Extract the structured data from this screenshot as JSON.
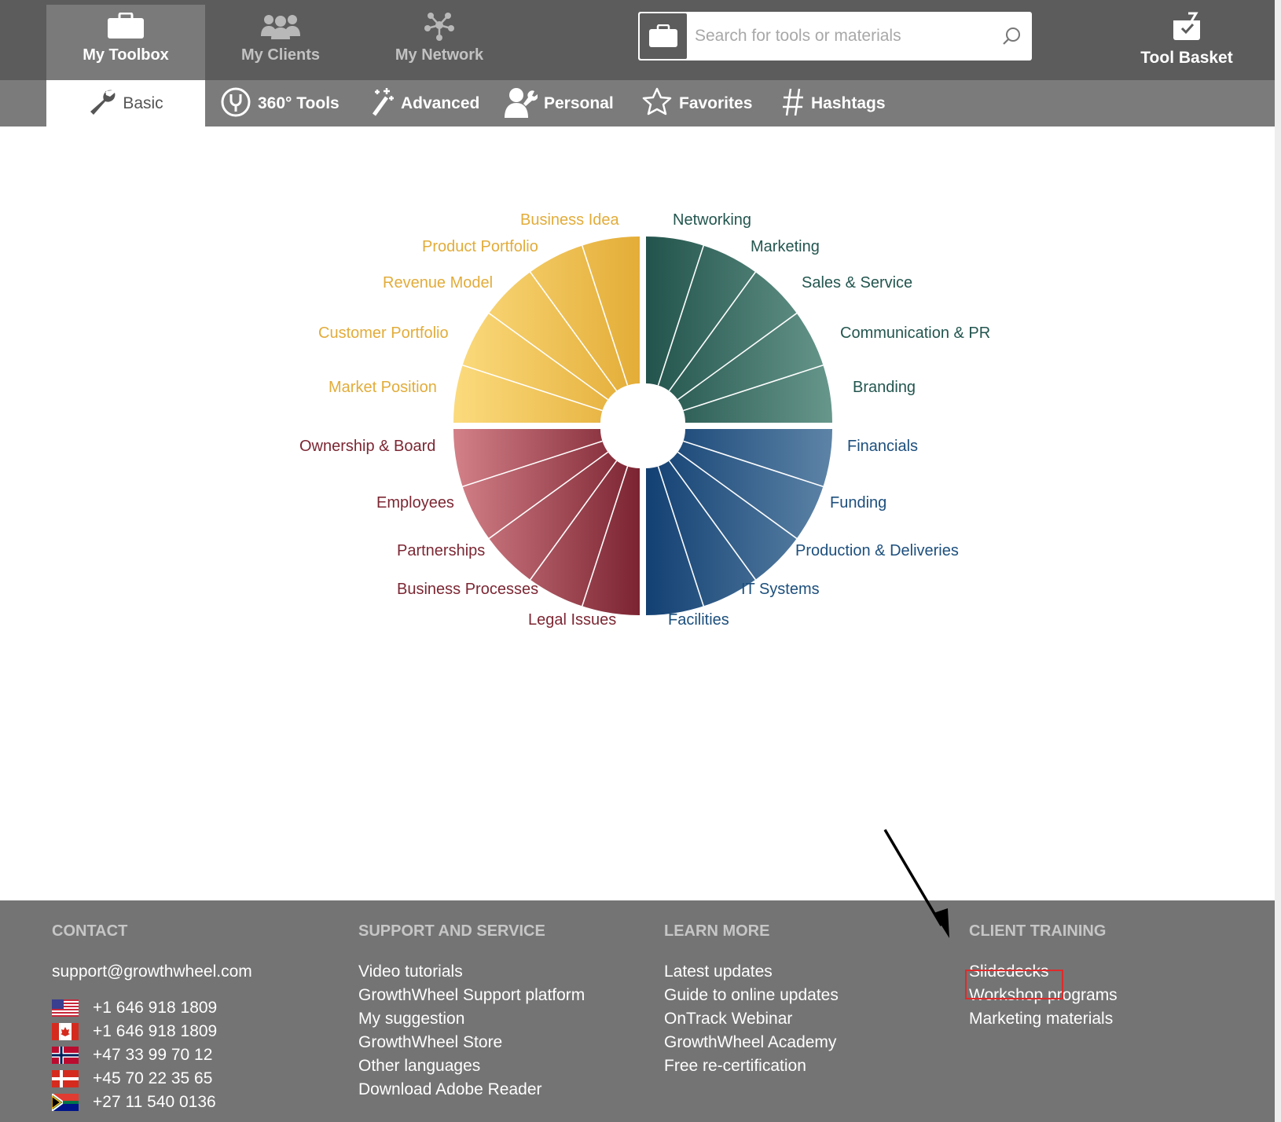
{
  "nav": {
    "main_tabs": [
      {
        "label": "My Toolbox",
        "icon": "toolbox-icon",
        "active": true
      },
      {
        "label": "My Clients",
        "icon": "clients-icon",
        "active": false
      },
      {
        "label": "My Network",
        "icon": "network-icon",
        "active": false
      }
    ],
    "search": {
      "placeholder": "Search for tools or materials",
      "value": ""
    },
    "basket_label": "Tool Basket",
    "sub_tabs": [
      {
        "label": "Basic",
        "icon": "wrench-icon",
        "active": true
      },
      {
        "label": "360° Tools",
        "icon": "tools-360-icon",
        "active": false
      },
      {
        "label": "Advanced",
        "icon": "magic-wand-icon",
        "active": false
      },
      {
        "label": "Personal",
        "icon": "person-wrench-icon",
        "active": false
      },
      {
        "label": "Favorites",
        "icon": "star-icon",
        "active": false
      },
      {
        "label": "Hashtags",
        "icon": "hashtag-icon",
        "active": false
      }
    ]
  },
  "wheel": {
    "colors": {
      "yellow": "#e5b23e",
      "teal": "#2a5e58",
      "red": "#7e2935",
      "blue": "#164f80",
      "yellow_text": "#e2ac3a",
      "teal_text": "#23564f",
      "red_text": "#7c2733",
      "blue_text": "#1c4f7d"
    },
    "segments": [
      {
        "label": "Business Idea",
        "group": "yellow"
      },
      {
        "label": "Product Portfolio",
        "group": "yellow"
      },
      {
        "label": "Revenue Model",
        "group": "yellow"
      },
      {
        "label": "Customer Portfolio",
        "group": "yellow"
      },
      {
        "label": "Market Position",
        "group": "yellow"
      },
      {
        "label": "Networking",
        "group": "teal"
      },
      {
        "label": "Marketing",
        "group": "teal"
      },
      {
        "label": "Sales & Service",
        "group": "teal"
      },
      {
        "label": "Communication & PR",
        "group": "teal"
      },
      {
        "label": "Branding",
        "group": "teal"
      },
      {
        "label": "Ownership & Board",
        "group": "red"
      },
      {
        "label": "Employees",
        "group": "red"
      },
      {
        "label": "Partnerships",
        "group": "red"
      },
      {
        "label": "Business Processes",
        "group": "red"
      },
      {
        "label": "Legal Issues",
        "group": "red"
      },
      {
        "label": "Financials",
        "group": "blue"
      },
      {
        "label": "Funding",
        "group": "blue"
      },
      {
        "label": "Production & Deliveries",
        "group": "blue"
      },
      {
        "label": "IT Systems",
        "group": "blue"
      },
      {
        "label": "Facilities",
        "group": "blue"
      }
    ]
  },
  "footer": {
    "contact": {
      "heading": "CONTACT",
      "email": "support@growthwheel.com",
      "phones": [
        {
          "flag": "us-flag-icon",
          "number": "+1 646 918 1809"
        },
        {
          "flag": "canada-flag-icon",
          "number": "+1 646 918 1809"
        },
        {
          "flag": "norway-flag-icon",
          "number": "+47 33 99 70 12"
        },
        {
          "flag": "denmark-flag-icon",
          "number": "+45 70 22 35 65"
        },
        {
          "flag": "south-africa-flag-icon",
          "number": "+27 11 540 0136"
        }
      ]
    },
    "support": {
      "heading": "SUPPORT AND SERVICE",
      "links": [
        "Video tutorials",
        "GrowthWheel Support platform",
        "My suggestion",
        "GrowthWheel Store",
        "Other languages",
        "Download Adobe Reader"
      ]
    },
    "learn": {
      "heading": "LEARN MORE",
      "links": [
        "Latest updates",
        "Guide to online updates",
        "OnTrack Webinar",
        "GrowthWheel Academy",
        "Free re-certification"
      ]
    },
    "training": {
      "heading": "CLIENT TRAINING",
      "links": [
        "Slidedecks",
        "Workshop programs",
        "Marketing materials"
      ],
      "highlighted": "Slidedecks"
    }
  }
}
